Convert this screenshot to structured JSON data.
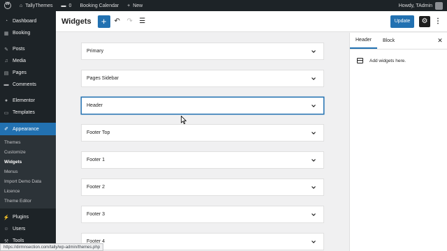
{
  "adminbar": {
    "site_name": "TallyThemes",
    "comments_count": "0",
    "booking_calendar": "Booking Calendar",
    "new_label": "New",
    "greeting": "Howdy, TAdmin"
  },
  "sidebar": {
    "items_top": [
      {
        "label": "Dashboard",
        "icon": "dashboard-icon"
      },
      {
        "label": "Booking",
        "icon": "calendar-icon"
      }
    ],
    "items_mid": [
      {
        "label": "Posts",
        "icon": "pin-icon"
      },
      {
        "label": "Media",
        "icon": "media-icon"
      },
      {
        "label": "Pages",
        "icon": "page-icon"
      },
      {
        "label": "Comments",
        "icon": "comment-icon"
      }
    ],
    "items_builder": [
      {
        "label": "Elementor",
        "icon": "elementor-icon"
      },
      {
        "label": "Templates",
        "icon": "folder-icon"
      }
    ],
    "appearance": {
      "label": "Appearance",
      "icon": "brush-icon"
    },
    "submenu": [
      "Themes",
      "Customize",
      "Widgets",
      "Menus",
      "Import Demo Data",
      "Licence",
      "Theme Editor"
    ],
    "submenu_current": "Widgets",
    "items_bottom": [
      {
        "label": "Plugins",
        "icon": "plugin-icon"
      },
      {
        "label": "Users",
        "icon": "users-icon"
      },
      {
        "label": "Tools",
        "icon": "tools-icon"
      }
    ]
  },
  "topbar": {
    "title": "Widgets",
    "add_label": "+",
    "update_label": "Update"
  },
  "widget_areas": [
    {
      "label": "Primary",
      "selected": false
    },
    {
      "label": "Pages Sidebar",
      "selected": false
    },
    {
      "label": "Header",
      "selected": true
    },
    {
      "label": "Footer Top",
      "selected": false
    },
    {
      "label": "Footer 1",
      "selected": false
    },
    {
      "label": "Footer 2",
      "selected": false
    },
    {
      "label": "Footer 3",
      "selected": false
    },
    {
      "label": "Footer 4",
      "selected": false
    }
  ],
  "panel": {
    "tab_header": "Header",
    "tab_block": "Block",
    "empty_message": "Add widgets here."
  },
  "statusbar": {
    "url": "https://dirmnsection.com/tally/wp-admin/themes.php"
  },
  "colors": {
    "accent": "#2271b1",
    "admin_dark": "#1d2327"
  }
}
